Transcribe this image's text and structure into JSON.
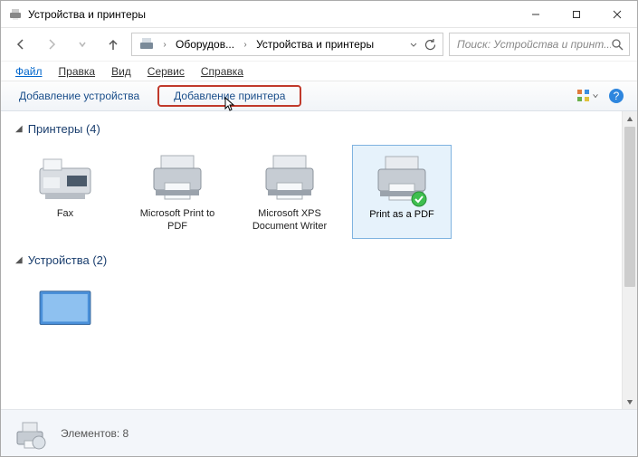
{
  "window": {
    "title": "Устройства и принтеры"
  },
  "breadcrumb": {
    "seg1": "Оборудов...",
    "seg2": "Устройства и принтеры"
  },
  "search": {
    "placeholder": "Поиск: Устройства и принт..."
  },
  "menu": {
    "file": "Файл",
    "edit": "Правка",
    "view": "Вид",
    "tools": "Сервис",
    "help": "Справка"
  },
  "toolbar": {
    "add_device": "Добавление устройства",
    "add_printer": "Добавление принтера"
  },
  "groups": {
    "printers": {
      "label": "Принтеры",
      "count": "(4)"
    },
    "devices": {
      "label": "Устройства",
      "count": "(2)"
    }
  },
  "printers": [
    {
      "label": "Fax",
      "type": "fax",
      "selected": false,
      "default": false
    },
    {
      "label": "Microsoft Print to PDF",
      "type": "printer",
      "selected": false,
      "default": false
    },
    {
      "label": "Microsoft XPS Document Writer",
      "type": "printer",
      "selected": false,
      "default": false
    },
    {
      "label": "Print as a PDF",
      "type": "printer",
      "selected": true,
      "default": true
    }
  ],
  "status": {
    "elements_label": "Элементов:",
    "elements_count": "8"
  }
}
